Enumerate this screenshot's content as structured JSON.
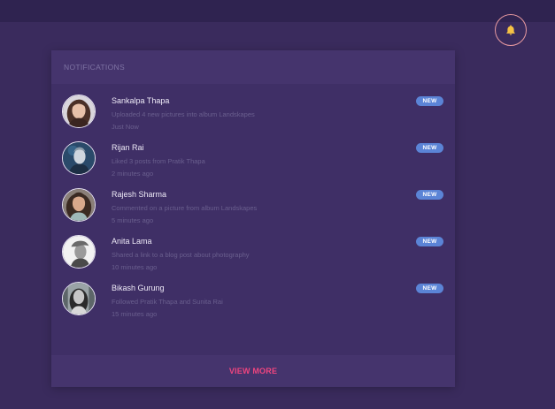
{
  "colors": {
    "background": "#3a2b5d",
    "topbar": "#2f2350",
    "panel": "#3f2f66",
    "panel_header": "#45346d",
    "badge": "#5b84d6",
    "accent": "#f0457f",
    "bell": "#f6c244",
    "bell_ring": "#e89aa0"
  },
  "header": {
    "bell_icon": "bell-icon"
  },
  "panel": {
    "title": "NOTIFICATIONS",
    "view_more": "VIEW MORE"
  },
  "notifications": [
    {
      "name": "Sankalpa Thapa",
      "message": "Uploaded 4 new pictures into album Landskapes",
      "time": "Just Now",
      "badge": "NEW"
    },
    {
      "name": "Rijan Rai",
      "message": "Liked 3 posts from Pratik Thapa",
      "time": "2 minutes ago",
      "badge": "NEW"
    },
    {
      "name": "Rajesh Sharma",
      "message": "Commented on a picture from album Landskapes",
      "time": "5 minutes ago",
      "badge": "NEW"
    },
    {
      "name": "Anita Lama",
      "message": "Shared a link to a blog post about photography",
      "time": "10 minutes ago",
      "badge": "NEW"
    },
    {
      "name": "Bikash Gurung",
      "message": "Followed Pratik Thapa and Sunita Rai",
      "time": "15 minutes ago",
      "badge": "NEW"
    }
  ]
}
